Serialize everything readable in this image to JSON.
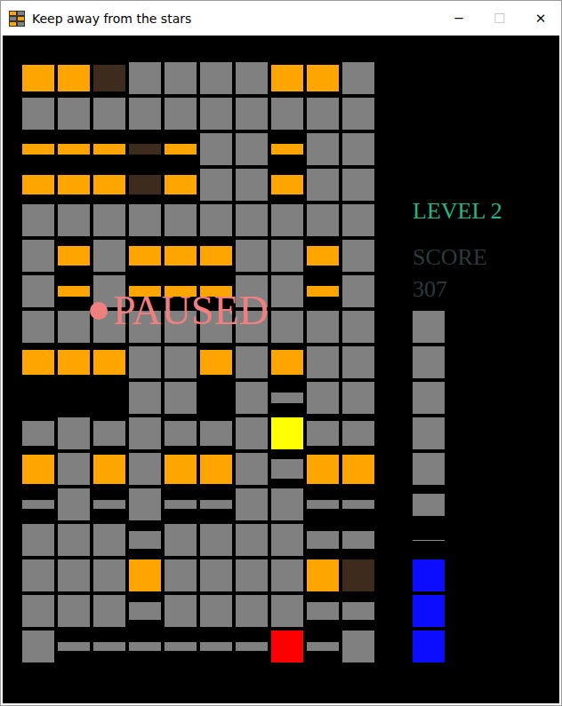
{
  "window": {
    "title": "Keep away from the stars",
    "controls": [
      {
        "glyph": "─",
        "disabled": false
      },
      {
        "glyph": "☐",
        "disabled": true
      },
      {
        "glyph": "✕",
        "disabled": false
      }
    ]
  },
  "grid": {
    "rows": [
      [
        {
          "kind": "star",
          "level": 0.83
        },
        {
          "kind": "star",
          "level": 0.83
        },
        {
          "kind": "dim",
          "level": 0.83
        },
        {
          "kind": "wall",
          "level": 1
        },
        {
          "kind": "wall",
          "level": 1
        },
        {
          "kind": "wall",
          "level": 1
        },
        {
          "kind": "wall",
          "level": 1
        },
        {
          "kind": "star",
          "level": 0.83
        },
        {
          "kind": "star",
          "level": 0.83
        },
        {
          "kind": "wall",
          "level": 1
        }
      ],
      [
        {
          "kind": "wall",
          "level": 1
        },
        {
          "kind": "wall",
          "level": 1
        },
        {
          "kind": "wall",
          "level": 1
        },
        {
          "kind": "wall",
          "level": 1
        },
        {
          "kind": "wall",
          "level": 1
        },
        {
          "kind": "wall",
          "level": 1
        },
        {
          "kind": "wall",
          "level": 1
        },
        {
          "kind": "wall",
          "level": 1
        },
        {
          "kind": "wall",
          "level": 1
        },
        {
          "kind": "wall",
          "level": 1
        }
      ],
      [
        {
          "kind": "star",
          "level": 0.33
        },
        {
          "kind": "star",
          "level": 0.33
        },
        {
          "kind": "star",
          "level": 0.33
        },
        {
          "kind": "dim",
          "level": 0.33
        },
        {
          "kind": "star",
          "level": 0.33
        },
        {
          "kind": "wall",
          "level": 1
        },
        {
          "kind": "wall",
          "level": 1
        },
        {
          "kind": "star",
          "level": 0.33
        },
        {
          "kind": "wall",
          "level": 1
        },
        {
          "kind": "wall",
          "level": 1
        }
      ],
      [
        {
          "kind": "star",
          "level": 0.6
        },
        {
          "kind": "star",
          "level": 0.6
        },
        {
          "kind": "star",
          "level": 0.6
        },
        {
          "kind": "dim",
          "level": 0.6
        },
        {
          "kind": "star",
          "level": 0.6
        },
        {
          "kind": "wall",
          "level": 1
        },
        {
          "kind": "wall",
          "level": 1
        },
        {
          "kind": "star",
          "level": 0.6
        },
        {
          "kind": "wall",
          "level": 1
        },
        {
          "kind": "wall",
          "level": 1
        }
      ],
      [
        {
          "kind": "wall",
          "level": 1
        },
        {
          "kind": "wall",
          "level": 1
        },
        {
          "kind": "wall",
          "level": 1
        },
        {
          "kind": "wall",
          "level": 1
        },
        {
          "kind": "wall",
          "level": 1
        },
        {
          "kind": "wall",
          "level": 1
        },
        {
          "kind": "wall",
          "level": 1
        },
        {
          "kind": "wall",
          "level": 1
        },
        {
          "kind": "wall",
          "level": 1
        },
        {
          "kind": "wall",
          "level": 1
        }
      ],
      [
        {
          "kind": "wall",
          "level": 1
        },
        {
          "kind": "star",
          "level": 0.6
        },
        {
          "kind": "wall",
          "level": 1
        },
        {
          "kind": "star",
          "level": 0.6
        },
        {
          "kind": "star",
          "level": 0.6
        },
        {
          "kind": "star",
          "level": 0.6
        },
        {
          "kind": "wall",
          "level": 1
        },
        {
          "kind": "wall",
          "level": 1
        },
        {
          "kind": "star",
          "level": 0.6
        },
        {
          "kind": "wall",
          "level": 1
        }
      ],
      [
        {
          "kind": "wall",
          "level": 1
        },
        {
          "kind": "star",
          "level": 0.33
        },
        {
          "kind": "wall",
          "level": 1
        },
        {
          "kind": "star",
          "level": 0.33
        },
        {
          "kind": "star",
          "level": 0.33
        },
        {
          "kind": "star",
          "level": 0.33
        },
        {
          "kind": "wall",
          "level": 1
        },
        {
          "kind": "wall",
          "level": 1
        },
        {
          "kind": "star",
          "level": 0.33
        },
        {
          "kind": "wall",
          "level": 1
        }
      ],
      [
        {
          "kind": "wall",
          "level": 1
        },
        {
          "kind": "wall",
          "level": 1
        },
        {
          "kind": "wall",
          "level": 1
        },
        {
          "kind": "wall",
          "level": 1
        },
        {
          "kind": "wall",
          "level": 1
        },
        {
          "kind": "wall",
          "level": 1
        },
        {
          "kind": "wall",
          "level": 1
        },
        {
          "kind": "wall",
          "level": 1
        },
        {
          "kind": "wall",
          "level": 1
        },
        {
          "kind": "wall",
          "level": 1
        }
      ],
      [
        {
          "kind": "star",
          "level": 0.78
        },
        {
          "kind": "star",
          "level": 0.78
        },
        {
          "kind": "star",
          "level": 0.78
        },
        {
          "kind": "wall",
          "level": 1
        },
        {
          "kind": "wall",
          "level": 1
        },
        {
          "kind": "star",
          "level": 0.78
        },
        {
          "kind": "wall",
          "level": 1
        },
        {
          "kind": "star",
          "level": 0.78
        },
        {
          "kind": "wall",
          "level": 1
        },
        {
          "kind": "wall",
          "level": 1
        }
      ],
      [
        {
          "kind": "empty",
          "level": 0
        },
        {
          "kind": "empty",
          "level": 0
        },
        {
          "kind": "empty",
          "level": 0
        },
        {
          "kind": "wall",
          "level": 1
        },
        {
          "kind": "wall",
          "level": 1
        },
        {
          "kind": "empty",
          "level": 0
        },
        {
          "kind": "wall",
          "level": 1
        },
        {
          "kind": "wall",
          "level": 0.33
        },
        {
          "kind": "wall",
          "level": 1
        },
        {
          "kind": "wall",
          "level": 1
        }
      ],
      [
        {
          "kind": "wall",
          "level": 0.78
        },
        {
          "kind": "wall",
          "level": 1
        },
        {
          "kind": "wall",
          "level": 0.78
        },
        {
          "kind": "wall",
          "level": 1
        },
        {
          "kind": "wall",
          "level": 0.78
        },
        {
          "kind": "wall",
          "level": 0.78
        },
        {
          "kind": "wall",
          "level": 1
        },
        {
          "kind": "player",
          "level": 1
        },
        {
          "kind": "wall",
          "level": 0.78
        },
        {
          "kind": "wall",
          "level": 0.78
        }
      ],
      [
        {
          "kind": "star",
          "level": 0.92
        },
        {
          "kind": "wall",
          "level": 1
        },
        {
          "kind": "star",
          "level": 0.92
        },
        {
          "kind": "wall",
          "level": 1
        },
        {
          "kind": "star",
          "level": 0.92
        },
        {
          "kind": "star",
          "level": 0.92
        },
        {
          "kind": "wall",
          "level": 1
        },
        {
          "kind": "wall",
          "level": 0.6
        },
        {
          "kind": "star",
          "level": 0.92
        },
        {
          "kind": "star",
          "level": 0.92
        }
      ],
      [
        {
          "kind": "wall",
          "level": 0.28
        },
        {
          "kind": "wall",
          "level": 1
        },
        {
          "kind": "wall",
          "level": 0.28
        },
        {
          "kind": "wall",
          "level": 1
        },
        {
          "kind": "wall",
          "level": 0.28
        },
        {
          "kind": "wall",
          "level": 0.28
        },
        {
          "kind": "wall",
          "level": 1
        },
        {
          "kind": "wall",
          "level": 1
        },
        {
          "kind": "wall",
          "level": 0.28
        },
        {
          "kind": "wall",
          "level": 0.28
        }
      ],
      [
        {
          "kind": "wall",
          "level": 1
        },
        {
          "kind": "wall",
          "level": 1
        },
        {
          "kind": "wall",
          "level": 1
        },
        {
          "kind": "wall",
          "level": 0.55
        },
        {
          "kind": "wall",
          "level": 1
        },
        {
          "kind": "wall",
          "level": 1
        },
        {
          "kind": "wall",
          "level": 1
        },
        {
          "kind": "wall",
          "level": 1
        },
        {
          "kind": "wall",
          "level": 0.55
        },
        {
          "kind": "wall",
          "level": 0.55
        }
      ],
      [
        {
          "kind": "wall",
          "level": 1
        },
        {
          "kind": "wall",
          "level": 1
        },
        {
          "kind": "wall",
          "level": 1
        },
        {
          "kind": "star",
          "level": 1
        },
        {
          "kind": "wall",
          "level": 1
        },
        {
          "kind": "wall",
          "level": 1
        },
        {
          "kind": "wall",
          "level": 1
        },
        {
          "kind": "wall",
          "level": 1
        },
        {
          "kind": "star",
          "level": 1
        },
        {
          "kind": "dim",
          "level": 1
        }
      ],
      [
        {
          "kind": "wall",
          "level": 1
        },
        {
          "kind": "wall",
          "level": 1
        },
        {
          "kind": "wall",
          "level": 1
        },
        {
          "kind": "wall",
          "level": 0.55
        },
        {
          "kind": "wall",
          "level": 1
        },
        {
          "kind": "wall",
          "level": 1
        },
        {
          "kind": "wall",
          "level": 1
        },
        {
          "kind": "wall",
          "level": 1
        },
        {
          "kind": "wall",
          "level": 0.55
        },
        {
          "kind": "wall",
          "level": 0.55
        }
      ],
      [
        {
          "kind": "wall",
          "level": 1
        },
        {
          "kind": "wall",
          "level": 0.28
        },
        {
          "kind": "wall",
          "level": 0.28
        },
        {
          "kind": "wall",
          "level": 0.28
        },
        {
          "kind": "wall",
          "level": 0.28
        },
        {
          "kind": "wall",
          "level": 0.28
        },
        {
          "kind": "wall",
          "level": 0.28
        },
        {
          "kind": "goal",
          "level": 1
        },
        {
          "kind": "wall",
          "level": 0.28
        },
        {
          "kind": "wall",
          "level": 1
        }
      ]
    ]
  },
  "sidebar": {
    "level_label": "LEVEL 2",
    "score_label": "SCORE",
    "score": "307",
    "tiles": [
      {
        "kind": "wall",
        "level": 1
      },
      {
        "kind": "wall",
        "level": 1
      },
      {
        "kind": "wall",
        "level": 1
      },
      {
        "kind": "wall",
        "level": 1
      },
      {
        "kind": "wall",
        "level": 1
      },
      {
        "kind": "wall",
        "level": 0.7
      },
      {
        "kind": "line",
        "level": 0.03
      },
      {
        "kind": "life",
        "level": 1
      },
      {
        "kind": "life",
        "level": 1
      },
      {
        "kind": "life",
        "level": 1
      }
    ]
  },
  "overlay": {
    "text": "PAUSED"
  }
}
